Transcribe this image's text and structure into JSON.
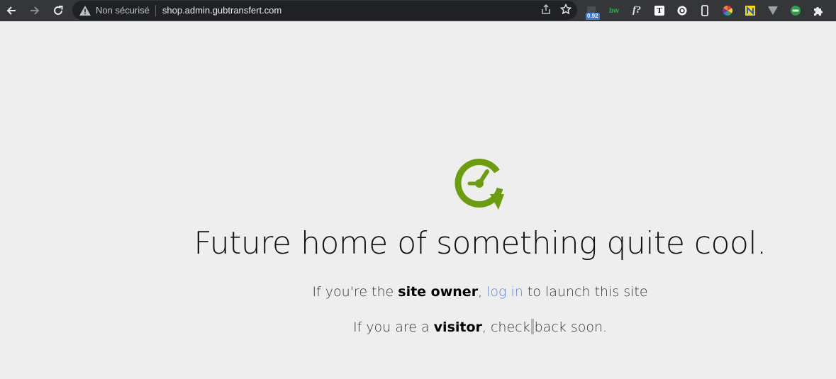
{
  "browser": {
    "security_label": "Non sécurisé",
    "url": "shop.admin.gubtransfert.com",
    "extension_badge": "0.92",
    "extensions": [
      "badge-extension-icon",
      "bw-icon",
      "font-query-icon",
      "t-square-icon",
      "circle-dot-icon",
      "phone-outline-icon",
      "color-wheel-icon",
      "yellow-n-icon",
      "v-triangle-icon",
      "green-circle-icon",
      "puzzle-icon"
    ],
    "ext_texts": {
      "bw": "bw",
      "fquery": "f?",
      "t": "T"
    }
  },
  "page": {
    "headline": "Future home of something quite cool.",
    "owner_line": {
      "prefix": "If you're the ",
      "bold": "site owner",
      "comma": ", ",
      "link": "log in",
      "suffix": " to launch this site"
    },
    "visitor_line": {
      "prefix": "If you are a ",
      "bold": "visitor",
      "middle": ", check",
      "suffix": "back soon."
    },
    "logo_color": "#6a9e0f"
  }
}
